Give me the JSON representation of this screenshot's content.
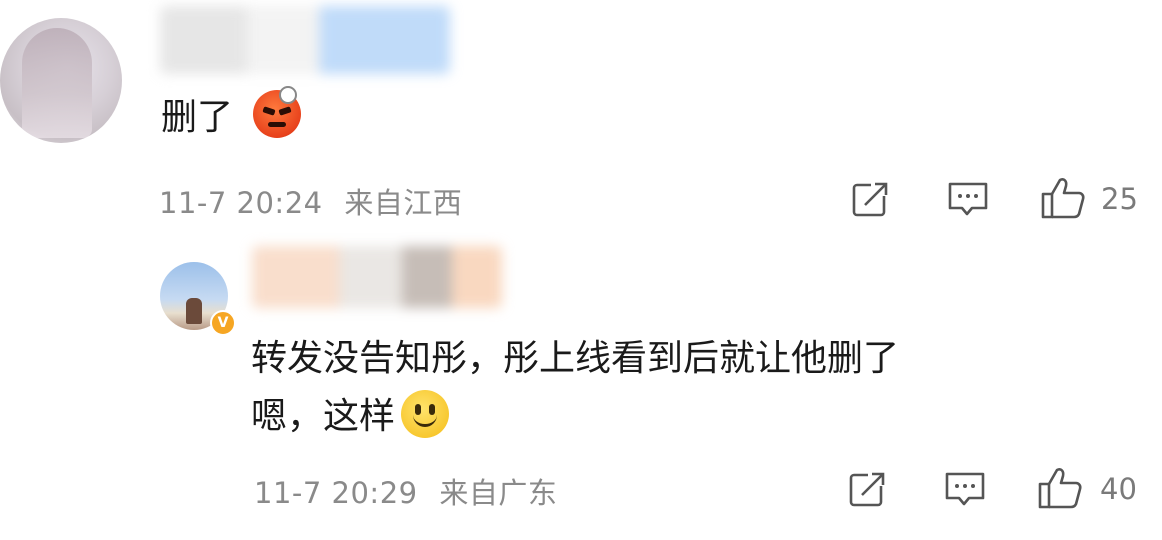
{
  "comments": [
    {
      "text": "删了",
      "emoji": "angry-face-emoji",
      "time": "11-7 20:24",
      "location": "来自江西",
      "likes": "25"
    },
    {
      "text_line1": "转发没告知彤，彤上线看到后就让他删了",
      "text_line2": "嗯，这样",
      "emoji": "smiling-face-emoji",
      "verified_badge": "V",
      "time": "11-7 20:29",
      "location": "来自广东",
      "likes": "40"
    }
  ],
  "icons": [
    "share-icon",
    "comment-icon",
    "like-icon"
  ],
  "colors": {
    "meta_text": "#8a8a8a",
    "icon_stroke": "#555555",
    "verified_badge": "#f6a623"
  }
}
